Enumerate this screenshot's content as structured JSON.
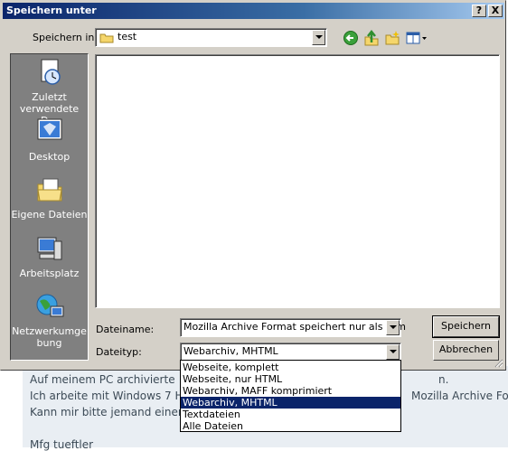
{
  "background_page": {
    "lines": [
      "Auf meinem PC archivierte",
      "Ich arbeite mit Windows 7 H",
      "Kann mir bitte jemand einen",
      "",
      "Mfg tueftler"
    ],
    "line_tail_1": "n.",
    "line_tail_2": "Mozilla Archive Form"
  },
  "dialog": {
    "title": "Speichern unter",
    "help_btn": "?",
    "close_btn": "X",
    "save_in_label": "Speichern in:",
    "save_in_value": "test",
    "toolbar_icons": [
      "back-icon",
      "up-folder-icon",
      "new-folder-icon",
      "view-menu-icon"
    ],
    "places": [
      {
        "label": "Zuletzt verwendete D...",
        "icon": "recent-documents-icon"
      },
      {
        "label": "Desktop",
        "icon": "desktop-icon"
      },
      {
        "label": "Eigene Dateien",
        "icon": "my-documents-icon"
      },
      {
        "label": "Arbeitsplatz",
        "icon": "my-computer-icon"
      },
      {
        "label": "Netzwerkumge bung",
        "icon": "network-icon"
      }
    ],
    "filename_label": "Dateiname:",
    "filename_value": "Mozilla Archive Format speichert nur als htm",
    "filetype_label": "Dateityp:",
    "filetype_value": "Webarchiv, MHTML",
    "save_button": "Speichern",
    "cancel_button": "Abbrechen",
    "filetype_options": [
      "Webseite, komplett",
      "Webseite, nur HTML",
      "Webarchiv, MAFF komprimiert",
      "Webarchiv, MHTML",
      "Textdateien",
      "Alle Dateien"
    ],
    "selected_option": "Webarchiv, MHTML",
    "colors": {
      "title_start": "#0a246a",
      "title_end": "#a6caf0",
      "face": "#d4d0c8",
      "places_bg": "#808080",
      "selection": "#0a246a"
    }
  }
}
